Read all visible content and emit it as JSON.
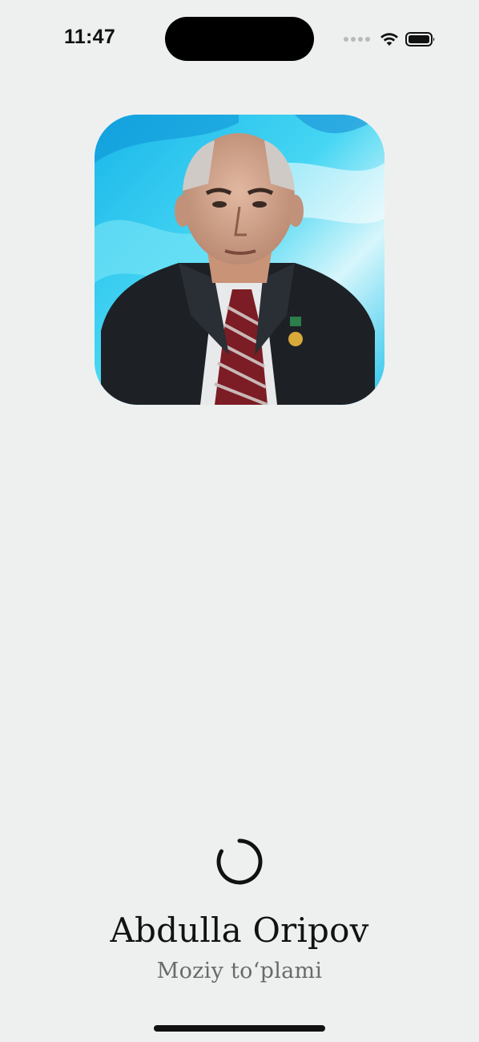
{
  "status_bar": {
    "time": "11:47",
    "icons": [
      "cellular-dots-icon",
      "wifi-icon",
      "battery-icon"
    ]
  },
  "portrait": {
    "icon": "author-portrait-image"
  },
  "loading": {
    "icon": "loading-spinner-icon"
  },
  "author": {
    "name": "Abdulla Oripov"
  },
  "collection": {
    "title": "Moziy to‘plami"
  },
  "colors": {
    "background": "#eef0f0",
    "portrait_bg": "#3fd3f1",
    "name_text": "#121212",
    "subtitle_text": "#6a6a6a"
  }
}
